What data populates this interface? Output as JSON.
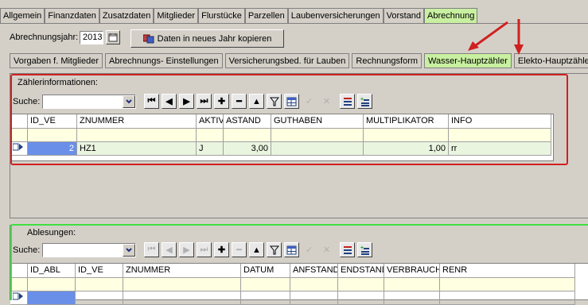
{
  "main_tabs": [
    "Allgemein",
    "Finanzdaten",
    "Zusatzdaten",
    "Mitglieder",
    "Flurstücke",
    "Parzellen",
    "Laubenversicherungen",
    "Vorstand",
    "Abrechnung"
  ],
  "active_main_tab": "Abrechnung",
  "year": {
    "label": "Abrechnungsjahr:",
    "value": "2013"
  },
  "copy_button": "Daten in neues Jahr kopieren",
  "sub_tabs": [
    "Vorgaben f. Mitglieder",
    "Abrechnungs- Einstellungen",
    "Versicherungsbed. für Lauben",
    "Rechnungsform",
    "Wasser-Hauptzähler",
    "Elekto-Hauptzähler"
  ],
  "active_sub_tab": "Wasser-Hauptzähler",
  "meters": {
    "section_label": "Zählerinformationen:",
    "search_label": "Suche:",
    "columns": [
      "ID_VE",
      "ZNUMMER",
      "AKTIV",
      "ASTAND",
      "GUTHABEN",
      "MULTIPLIKATOR",
      "INFO"
    ],
    "row": [
      "2",
      "HZ1",
      "J",
      "3,00",
      "",
      "1,00",
      "rr"
    ]
  },
  "readings": {
    "section_label": "Ablesungen:",
    "search_label": "Suche:",
    "columns": [
      "ID_ABL",
      "ID_VE",
      "ZNUMMER",
      "DATUM",
      "ANFSTAND",
      "ENDSTAND",
      "VERBRAUCH",
      "RENR"
    ]
  },
  "colors": {
    "active_tab": "#c8f0a0",
    "highlight_red": "#d02020",
    "highlight_green": "#40e040",
    "arrow": "#d02020"
  }
}
